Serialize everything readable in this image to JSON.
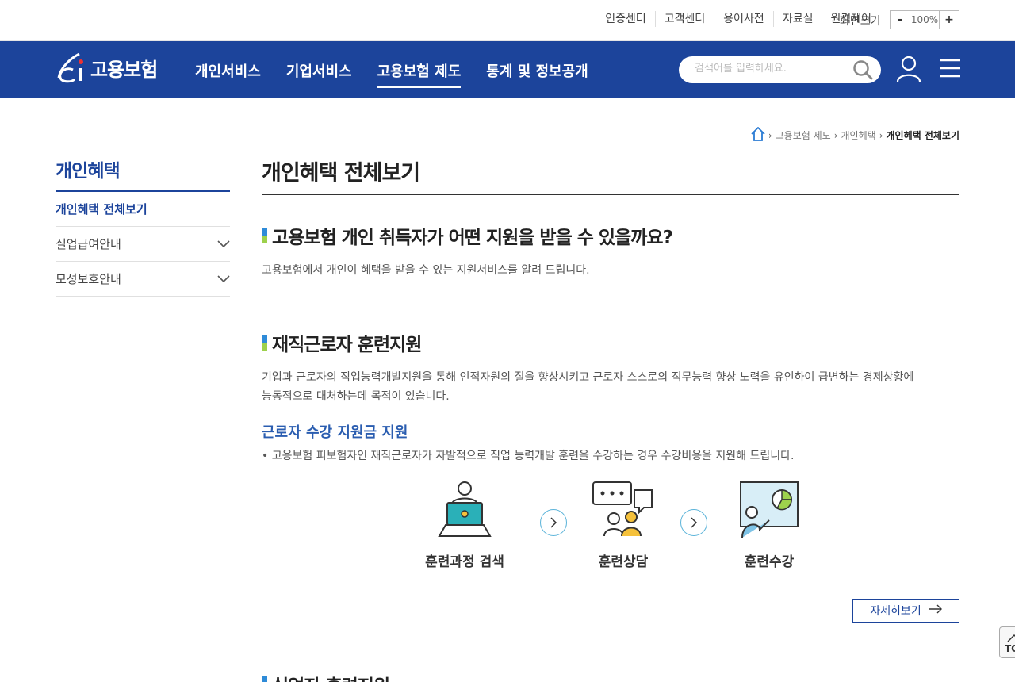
{
  "util": {
    "links": [
      "인증센터",
      "고객센터",
      "용어사전",
      "자료실",
      "원격제어"
    ],
    "zoom_label": "화면크기",
    "zoom_minus": "-",
    "zoom_value": "100%",
    "zoom_plus": "+"
  },
  "header": {
    "logo_text": "고용보험",
    "nav": [
      "개인서비스",
      "기업서비스",
      "고용보험 제도",
      "통계 및 정보공개"
    ],
    "active_nav_index": 2,
    "search_placeholder": "검색어를 입력하세요."
  },
  "breadcrumb": {
    "items": [
      "고용보험 제도",
      "개인혜택"
    ],
    "current": "개인혜택 전체보기"
  },
  "lnb": {
    "title": "개인혜택",
    "items": [
      {
        "label": "개인혜택 전체보기",
        "active": true
      },
      {
        "label": "실업급여안내"
      },
      {
        "label": "모성보호안내"
      }
    ]
  },
  "content": {
    "page_title": "개인혜택 전체보기",
    "intro_heading": "고용보험 개인 취득자가 어떤 지원을 받을 수 있을까요?",
    "intro_text": "고용보험에서 개인이 혜택을 받을 수 있는 지원서비스를 알려 드립니다.",
    "section1": {
      "heading": "재직근로자 훈련지원",
      "text_line1": "기업과 근로자의 직업능력개발지원을 통해 인적자원의 질을 향상시키고 근로자 스스로의 직무능력 향상 노력을 유인하여 급변하는 경제상황에",
      "text_line2": "능동적으로 대처하는데 목적이 있습니다.",
      "sub_heading": "근로자 수강 지원금 지원",
      "bullet": "고용보험 피보험자인 재직근로자가 자발적으로 직업 능력개발 훈련을 수강하는 경우 수강비용을 지원해 드립니다.",
      "steps": [
        "훈련과정 검색",
        "훈련상담",
        "훈련수강"
      ],
      "more_label": "자세히보기"
    },
    "section2_heading": "실업자 훈련지원"
  },
  "top_button": "TOP",
  "colors": {
    "brand": "#1c449b",
    "accent_blue": "#2a5db0",
    "accent_green": "#9dd14c",
    "accent_teal": "#2ab0b8"
  }
}
